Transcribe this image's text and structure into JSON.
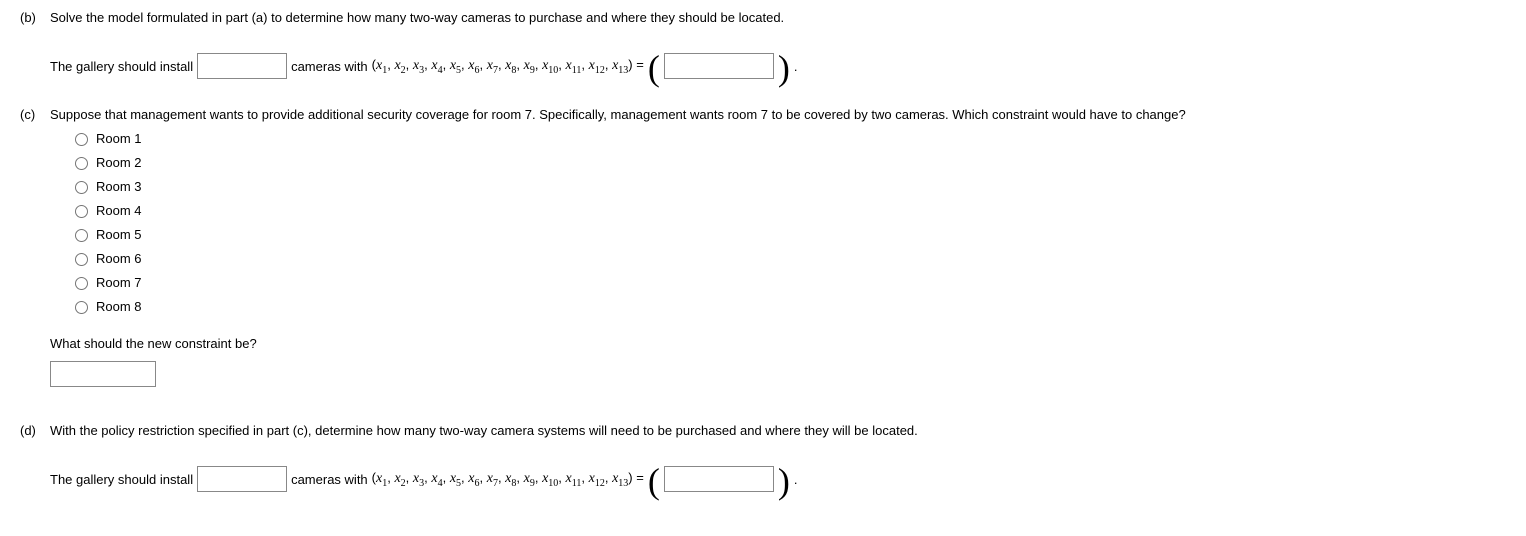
{
  "partB": {
    "label": "(b)",
    "prompt": "Solve the model formulated in part (a) to determine how many two-way cameras to purchase and where they should be located.",
    "sentence_prefix": "The gallery should install",
    "sentence_mid": "cameras with",
    "vars_open": "(",
    "vars_close": ") =",
    "period": "."
  },
  "partC": {
    "label": "(c)",
    "prompt": "Suppose that management wants to provide additional security coverage for room 7. Specifically, management wants room 7 to be covered by two cameras. Which constraint would have to change?",
    "options": [
      "Room 1",
      "Room 2",
      "Room 3",
      "Room 4",
      "Room 5",
      "Room 6",
      "Room 7",
      "Room 8"
    ],
    "sub_question": "What should the new constraint be?"
  },
  "partD": {
    "label": "(d)",
    "prompt": "With the policy restriction specified in part (c), determine how many two-way camera systems will need to be purchased and where they will be located.",
    "sentence_prefix": "The gallery should install",
    "sentence_mid": "cameras with",
    "vars_open": "(",
    "vars_close": ") =",
    "period": "."
  },
  "var_letter": "x",
  "var_indices": [
    "1",
    "2",
    "3",
    "4",
    "5",
    "6",
    "7",
    "8",
    "9",
    "10",
    "11",
    "12",
    "13"
  ]
}
